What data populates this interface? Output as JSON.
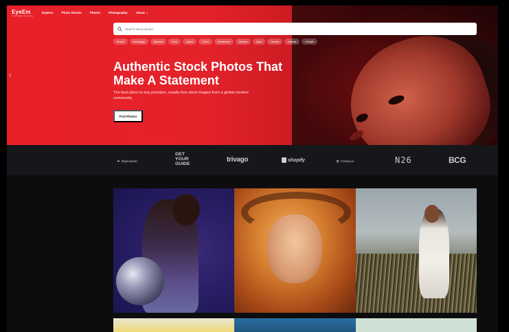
{
  "nav": {
    "logo": "EyeEm",
    "logo_sub": "by Freepik Company",
    "links": [
      "Explore",
      "Photo Stories",
      "Photos",
      "Photography",
      "About"
    ]
  },
  "search": {
    "placeholder": "Search stock photos"
  },
  "chips": [
    "People",
    "Technology",
    "Business",
    "Food",
    "Nature",
    "Travel",
    "Architecture",
    "Abstract",
    "Sport",
    "Fashion",
    "Animals",
    "Lifestyle"
  ],
  "hero": {
    "headline": "Authentic Stock Photos That Make A Statement",
    "subtext": "The best place to buy premium, royalty-free stock images from a global creative community.",
    "cta": "Find Photos"
  },
  "brands": {
    "skyscanner": "Skyscanner",
    "getyourguide": "GET YOUR GUIDE",
    "trivago": "trivago",
    "shopify": "shopify",
    "twin": "TERMINUS",
    "n26": "N26",
    "bcg": "BCG"
  },
  "colors": {
    "hero_red": "#e8202a",
    "strip_bg": "#16171b"
  },
  "icons": [
    "search-icon",
    "chevron-left-icon",
    "chevron-down-icon"
  ]
}
